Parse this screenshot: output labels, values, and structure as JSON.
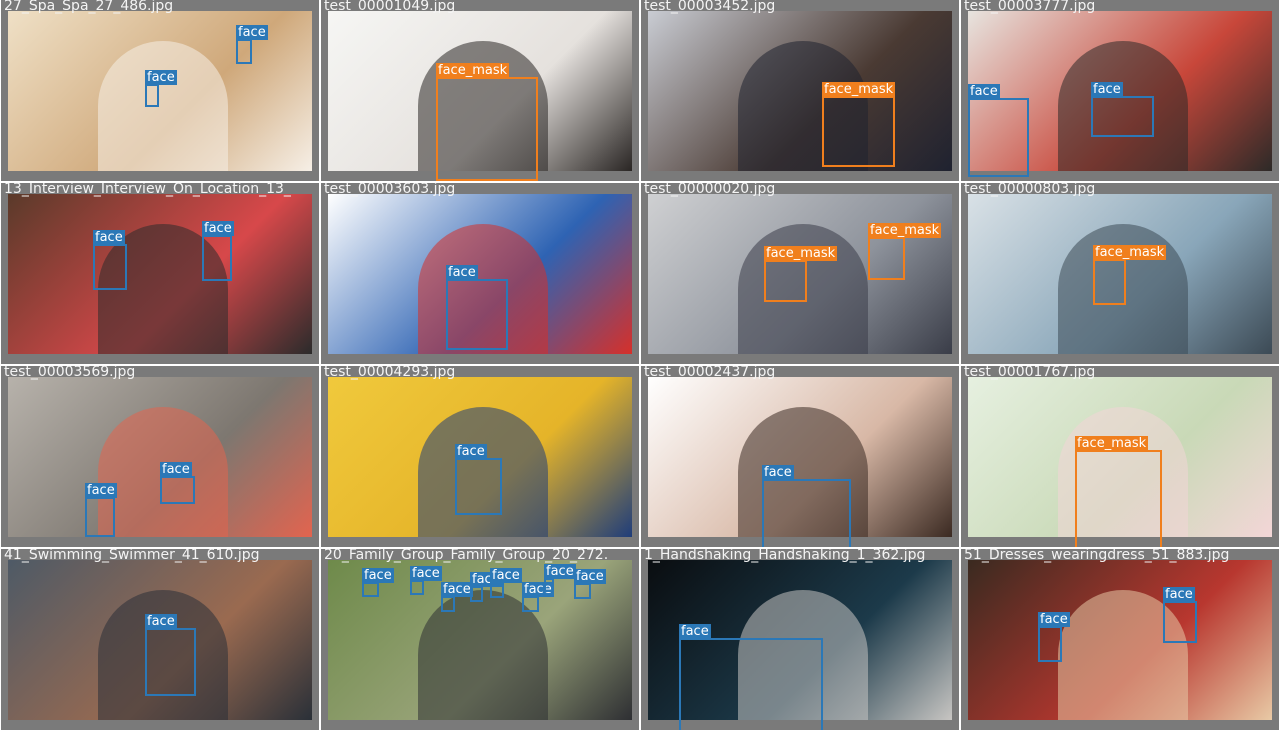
{
  "classes": {
    "face": {
      "label": "face",
      "color": "#2b78b7"
    },
    "face_mask": {
      "label": "face_mask",
      "color": "#f07f1d"
    }
  },
  "tiles": [
    {
      "title": "27_Spa_Spa_27_486.jpg",
      "photo": [
        "#efe0c6",
        "#cfa87a",
        "#f6efe6"
      ],
      "boxes": [
        {
          "cls": "face"
        },
        {
          "cls": "face"
        }
      ]
    },
    {
      "title": "test_00001049.jpg",
      "photo": [
        "#f6f6f4",
        "#e5e1dd",
        "#2a2624"
      ],
      "boxes": [
        {
          "cls": "face_mask"
        }
      ]
    },
    {
      "title": "test_00003452.jpg",
      "photo": [
        "#c9ccd3",
        "#4a3a33",
        "#1f2230"
      ],
      "boxes": [
        {
          "cls": "face_mask"
        }
      ]
    },
    {
      "title": "test_00003777.jpg",
      "photo": [
        "#e7e4df",
        "#c8473a",
        "#2d2a28"
      ],
      "boxes": [
        {
          "cls": "face"
        },
        {
          "cls": "face"
        }
      ]
    },
    {
      "title": "13_Interview_Interview_On_Location_13_",
      "photo": [
        "#5a3a2a",
        "#d7484a",
        "#2b2b2b"
      ],
      "boxes": [
        {
          "cls": "face"
        },
        {
          "cls": "face"
        }
      ]
    },
    {
      "title": "test_00003603.jpg",
      "photo": [
        "#ffffff",
        "#2e63b3",
        "#d6302a"
      ],
      "boxes": [
        {
          "cls": "face"
        }
      ]
    },
    {
      "title": "test_00000020.jpg",
      "photo": [
        "#cfd0d2",
        "#8e939c",
        "#3a3d48"
      ],
      "boxes": [
        {
          "cls": "face_mask"
        },
        {
          "cls": "face_mask"
        }
      ]
    },
    {
      "title": "test_00000803.jpg",
      "photo": [
        "#d9e1e6",
        "#89a6b9",
        "#3c4a55"
      ],
      "boxes": [
        {
          "cls": "face_mask"
        }
      ]
    },
    {
      "title": "test_00003569.jpg",
      "photo": [
        "#b7b2ab",
        "#7d7770",
        "#e2644f"
      ],
      "boxes": [
        {
          "cls": "face"
        },
        {
          "cls": "face"
        }
      ]
    },
    {
      "title": "test_00004293.jpg",
      "photo": [
        "#f0c93c",
        "#e5b429",
        "#1f3d7a"
      ],
      "boxes": [
        {
          "cls": "face"
        }
      ]
    },
    {
      "title": "test_00002437.jpg",
      "photo": [
        "#ffffff",
        "#d8b8a6",
        "#3b2a22"
      ],
      "boxes": [
        {
          "cls": "face"
        }
      ]
    },
    {
      "title": "test_00001767.jpg",
      "photo": [
        "#e6f0e0",
        "#c9d9b7",
        "#f3d6d7"
      ],
      "boxes": [
        {
          "cls": "face_mask"
        }
      ]
    },
    {
      "title": "41_Swimming_Swimmer_41_610.jpg",
      "photo": [
        "#4e5a66",
        "#9a6a50",
        "#2a3038"
      ],
      "boxes": [
        {
          "cls": "face"
        }
      ]
    },
    {
      "title": "20_Family_Group_Family_Group_20_272.",
      "photo": [
        "#6e8a4a",
        "#9aa47a",
        "#2e2f33"
      ],
      "boxes": [
        {
          "cls": "face"
        },
        {
          "cls": "face"
        },
        {
          "cls": "face"
        },
        {
          "cls": "face"
        },
        {
          "cls": "face"
        },
        {
          "cls": "face"
        },
        {
          "cls": "face"
        },
        {
          "cls": "face"
        }
      ]
    },
    {
      "title": "1_Handshaking_Handshaking_1_362.jpg",
      "photo": [
        "#0a0d10",
        "#1c3a4a",
        "#c7c5c2"
      ],
      "boxes": [
        {
          "cls": "face"
        }
      ]
    },
    {
      "title": "51_Dresses_wearingdress_51_883.jpg",
      "photo": [
        "#3a2a20",
        "#b8372f",
        "#e8c9a5"
      ],
      "boxes": [
        {
          "cls": "face"
        },
        {
          "cls": "face"
        }
      ]
    }
  ]
}
